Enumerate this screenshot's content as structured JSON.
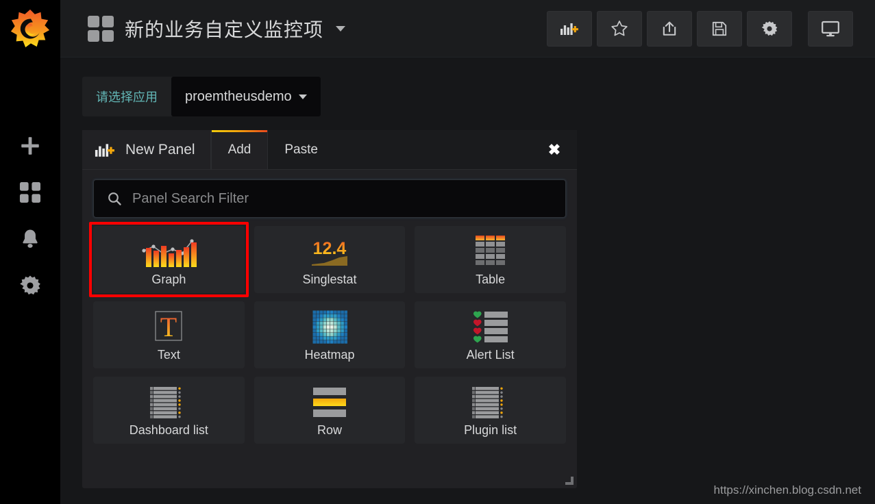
{
  "sidebar": {
    "logo_name": "grafana-logo",
    "items": [
      {
        "name": "create",
        "icon": "plus-icon"
      },
      {
        "name": "dashboards",
        "icon": "dashboards-icon"
      },
      {
        "name": "alerting",
        "icon": "bell-icon"
      },
      {
        "name": "configuration",
        "icon": "gear-icon"
      }
    ]
  },
  "navbar": {
    "dashboard_icon": "dashboard-squares-icon",
    "title": "新的业务自定义监控项",
    "caret": "chevron-down-icon",
    "actions": [
      {
        "name": "add-panel",
        "icon": "add-panel-icon"
      },
      {
        "name": "star",
        "icon": "star-icon"
      },
      {
        "name": "share",
        "icon": "share-icon"
      },
      {
        "name": "save",
        "icon": "save-icon"
      },
      {
        "name": "settings",
        "icon": "gear-icon"
      },
      {
        "name": "tv-mode",
        "icon": "monitor-icon"
      }
    ]
  },
  "submenu": {
    "variable_label": "请选择应用",
    "variable_value": "proemtheusdemo"
  },
  "dialog": {
    "section_label": "New Panel",
    "section_icon": "add-panel-icon",
    "tabs": [
      {
        "label": "Add",
        "active": true
      },
      {
        "label": "Paste",
        "active": false
      }
    ],
    "close_label": "✖",
    "search": {
      "placeholder": "Panel Search Filter",
      "value": "",
      "icon": "search-icon"
    },
    "panel_types": [
      {
        "label": "Graph",
        "icon": "graph-icon",
        "highlighted": true
      },
      {
        "label": "Singlestat",
        "icon": "singlestat-icon",
        "highlighted": false
      },
      {
        "label": "Table",
        "icon": "table-icon",
        "highlighted": false
      },
      {
        "label": "Text",
        "icon": "text-icon",
        "highlighted": false
      },
      {
        "label": "Heatmap",
        "icon": "heatmap-icon",
        "highlighted": false
      },
      {
        "label": "Alert List",
        "icon": "alert-list-icon",
        "highlighted": false
      },
      {
        "label": "Dashboard list",
        "icon": "dashboard-list-icon",
        "highlighted": false
      },
      {
        "label": "Row",
        "icon": "row-icon",
        "highlighted": false
      },
      {
        "label": "Plugin list",
        "icon": "plugin-list-icon",
        "highlighted": false
      }
    ],
    "singlestat_value": "12.4",
    "text_glyph": "T"
  },
  "watermark": "https://xinchen.blog.csdn.net",
  "colors": {
    "accent_orange": "#e8791d",
    "accent_yellow": "#f2cc0c",
    "variable_label": "#63b7b7",
    "highlight_red": "#ff0000",
    "panel_bg": "#26272a",
    "dialog_bg": "#212124",
    "page_bg": "#161719"
  }
}
